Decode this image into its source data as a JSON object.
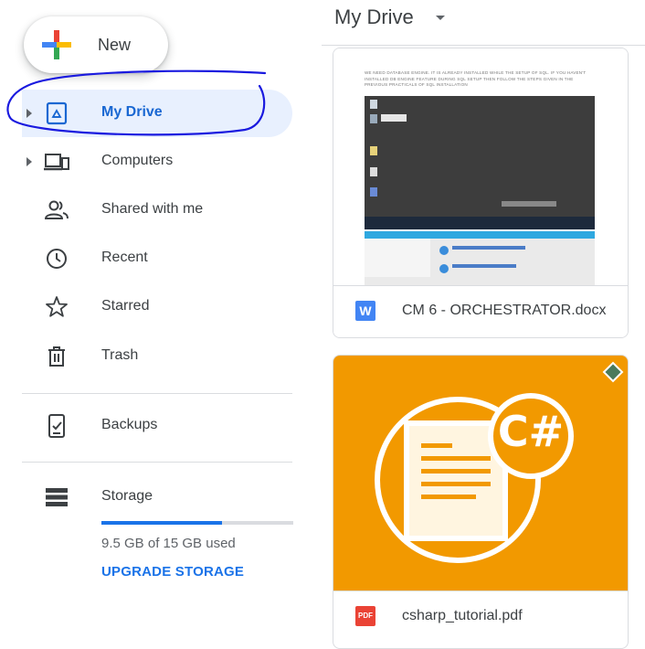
{
  "new_button": {
    "label": "New"
  },
  "header": {
    "title": "My Drive"
  },
  "sidebar": {
    "items": [
      {
        "label": "My Drive",
        "icon": "my-drive-icon",
        "active": true
      },
      {
        "label": "Computers",
        "icon": "computers-icon"
      },
      {
        "label": "Shared with me",
        "icon": "shared-with-me-icon"
      },
      {
        "label": "Recent",
        "icon": "clock-icon"
      },
      {
        "label": "Starred",
        "icon": "star-icon"
      },
      {
        "label": "Trash",
        "icon": "trash-icon"
      },
      {
        "label": "Backups",
        "icon": "backups-icon"
      },
      {
        "label": "Storage",
        "icon": "storage-icon"
      }
    ]
  },
  "storage": {
    "used_text": "9.5 GB of 15 GB used",
    "used_fraction": 0.63,
    "upgrade_label": "UPGRADE STORAGE"
  },
  "files": [
    {
      "name": "CM 6 - ORCHESTRATOR.docx",
      "type_badge": "W",
      "type_color": "#4285f4",
      "preview_text": "WE NEED DATABASE ENGINE. IT IS ALREADY INSTALLED WHILE THE SETUP OF SQL. IF YOU HAVEN'T INSTALLED DB ENGINE FEATURE DURING SQL SETUP THEN FOLLOW THE STEPS GIVEN IN THE PREVIOUS PRACTICALS OF SQL INSTALLATION"
    },
    {
      "name": "csharp_tutorial.pdf",
      "type_badge": "PDF",
      "type_color": "#ea4335",
      "thumb_color": "#f29900",
      "thumb_label": "C#"
    }
  ],
  "colors": {
    "accent": "#1a73e8",
    "active_bg": "#e8f0fe",
    "annotation": "#1a1adf"
  }
}
